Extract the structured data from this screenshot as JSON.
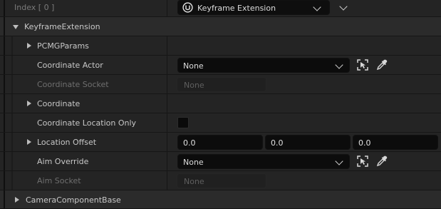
{
  "header": {
    "index_label": "Index [ 0 ]",
    "class_picker": {
      "selected": "Keyframe Extension",
      "icon": "unreal-logo-icon"
    }
  },
  "sections": {
    "keyframe_extension": {
      "label": "KeyframeExtension",
      "expanded": true
    },
    "camera_component_base": {
      "label": "CameraComponentBase",
      "expanded": false
    }
  },
  "properties": {
    "pcmg_params": {
      "label": "PCMGParams",
      "expanded": false
    },
    "coordinate_actor": {
      "label": "Coordinate Actor",
      "value": "None"
    },
    "coordinate_socket": {
      "label": "Coordinate Socket",
      "value": "None"
    },
    "coordinate": {
      "label": "Coordinate",
      "expanded": false
    },
    "coordinate_location_only": {
      "label": "Coordinate Location Only",
      "checked": false
    },
    "location_offset": {
      "label": "Location Offset",
      "x": "0.0",
      "y": "0.0",
      "z": "0.0"
    },
    "aim_override": {
      "label": "Aim Override",
      "value": "None"
    },
    "aim_socket": {
      "label": "Aim Socket",
      "value": "None"
    }
  },
  "icons": [
    "unreal-logo-icon",
    "browse-actor-icon",
    "eyedropper-icon",
    "chevron-down-icon"
  ]
}
